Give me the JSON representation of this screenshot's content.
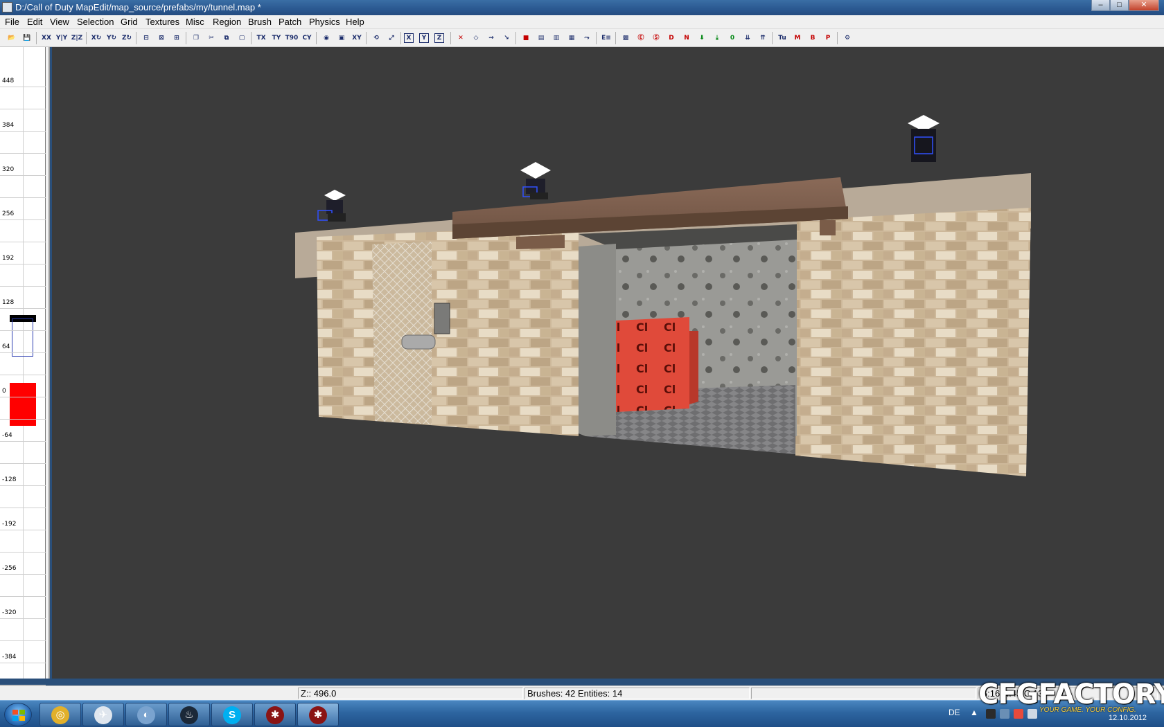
{
  "window": {
    "title": "D:/Call of Duty MapEdit/map_source/prefabs/my/tunnel.map *",
    "controls": {
      "minimize": "–",
      "maximize": "□",
      "close": "✕"
    }
  },
  "menu": {
    "items": [
      "File",
      "Edit",
      "View",
      "Selection",
      "Grid",
      "Textures",
      "Misc",
      "Region",
      "Brush",
      "Patch",
      "Physics",
      "Help"
    ]
  },
  "toolbar": {
    "buttons": [
      {
        "name": "open-icon",
        "glyph": "📂"
      },
      {
        "name": "save-icon",
        "glyph": "💾"
      },
      {
        "name": "flip-x-icon",
        "glyph": "XX"
      },
      {
        "name": "flip-y-icon",
        "glyph": "Y|Y"
      },
      {
        "name": "flip-z-icon",
        "glyph": "Z|Z"
      },
      {
        "name": "rotate-x-icon",
        "glyph": "X↻"
      },
      {
        "name": "rotate-y-icon",
        "glyph": "Y↻"
      },
      {
        "name": "rotate-z-icon",
        "glyph": "Z↻"
      },
      {
        "name": "csg-subtract-icon",
        "glyph": "⊟"
      },
      {
        "name": "csg-hollow-icon",
        "glyph": "⊠"
      },
      {
        "name": "csg-merge-icon",
        "glyph": "⊞"
      },
      {
        "name": "clone-icon",
        "glyph": "❐"
      },
      {
        "name": "clipper-icon",
        "glyph": "✂"
      },
      {
        "name": "copy-icon",
        "glyph": "⧉"
      },
      {
        "name": "select-box-icon",
        "glyph": "▢"
      },
      {
        "name": "tex-flip-x-icon",
        "glyph": "TX"
      },
      {
        "name": "tex-flip-y-icon",
        "glyph": "TY"
      },
      {
        "name": "tex-rotate-icon",
        "glyph": "T90"
      },
      {
        "name": "cycle-layer-icon",
        "glyph": "CY"
      },
      {
        "name": "render-sphere-icon",
        "glyph": "◉"
      },
      {
        "name": "camera-icon",
        "glyph": "▣"
      },
      {
        "name": "xy-view-icon",
        "glyph": "XY"
      },
      {
        "name": "rotate-view-icon",
        "glyph": "⟲"
      },
      {
        "name": "scale-icon",
        "glyph": "⤢"
      },
      {
        "name": "axis-x-icon",
        "glyph": "X"
      },
      {
        "name": "axis-y-icon",
        "glyph": "Y"
      },
      {
        "name": "axis-z-icon",
        "glyph": "Z"
      },
      {
        "name": "drag-edge-icon",
        "glyph": "✕"
      },
      {
        "name": "drag-vertex-icon",
        "glyph": "◇"
      },
      {
        "name": "path-icon",
        "glyph": "⇝"
      },
      {
        "name": "snap-icon",
        "glyph": "↘"
      },
      {
        "name": "entity-icon",
        "glyph": "■"
      },
      {
        "name": "brush-icon",
        "glyph": "▤"
      },
      {
        "name": "patch-icon",
        "glyph": "▥"
      },
      {
        "name": "grid-icon",
        "glyph": "▦"
      },
      {
        "name": "cull-icon",
        "glyph": "⤳"
      },
      {
        "name": "entity-list-icon",
        "glyph": "E≡"
      },
      {
        "name": "filter-icon",
        "glyph": "▩"
      },
      {
        "name": "no-e-icon",
        "glyph": "Ⓔ"
      },
      {
        "name": "no-s-icon",
        "glyph": "Ⓢ"
      },
      {
        "name": "d-icon",
        "glyph": "D"
      },
      {
        "name": "n-icon",
        "glyph": "N"
      },
      {
        "name": "arrow-down-icon",
        "glyph": "⬇"
      },
      {
        "name": "arrow-down-alt-icon",
        "glyph": "⤓"
      },
      {
        "name": "zero-icon",
        "glyph": "0"
      },
      {
        "name": "lights-icon",
        "glyph": "⇊"
      },
      {
        "name": "lights-alt-icon",
        "glyph": "⇈"
      },
      {
        "name": "tu-icon",
        "glyph": "Tu"
      },
      {
        "name": "m-icon",
        "glyph": "M"
      },
      {
        "name": "b-icon",
        "glyph": "B"
      },
      {
        "name": "p-icon",
        "glyph": "P"
      },
      {
        "name": "plugin-icon",
        "glyph": "⚙"
      }
    ]
  },
  "zruler": {
    "labels": [
      "448",
      "384",
      "320",
      "256",
      "192",
      "128",
      "64",
      "0",
      "-64",
      "-128",
      "-192",
      "-256",
      "-320",
      "-384"
    ]
  },
  "statusbar": {
    "z_readout": "Z:: 496.0",
    "counts": "Brushes: 42 Entities: 14",
    "extra": "G:16 R:45 C:13"
  },
  "taskbar": {
    "apps": [
      {
        "name": "chrome-icon",
        "glyph": "◎",
        "color": "#e2b02a"
      },
      {
        "name": "explorer-icon",
        "glyph": "✈",
        "color": "#dfe6ee"
      },
      {
        "name": "media-icon",
        "glyph": "◐",
        "color": "#7aa3cf"
      },
      {
        "name": "steam-icon",
        "glyph": "♨",
        "color": "#1b2838"
      },
      {
        "name": "skype-icon",
        "glyph": "S",
        "color": "#00aff0"
      },
      {
        "name": "radiant-icon",
        "glyph": "✱",
        "color": "#8a1414"
      },
      {
        "name": "radiant-active-icon",
        "glyph": "✱",
        "color": "#8a1414"
      }
    ],
    "language": "DE",
    "date": "12.10.2012"
  },
  "watermark": {
    "main": "CFGFACTORY",
    "sub": "YOUR GAME. YOUR CONFIG."
  },
  "colors": {
    "selected_brush": "#ff0000",
    "viewport_bg": "#3b3b3b",
    "camera_marker": "#2a3bb0"
  }
}
